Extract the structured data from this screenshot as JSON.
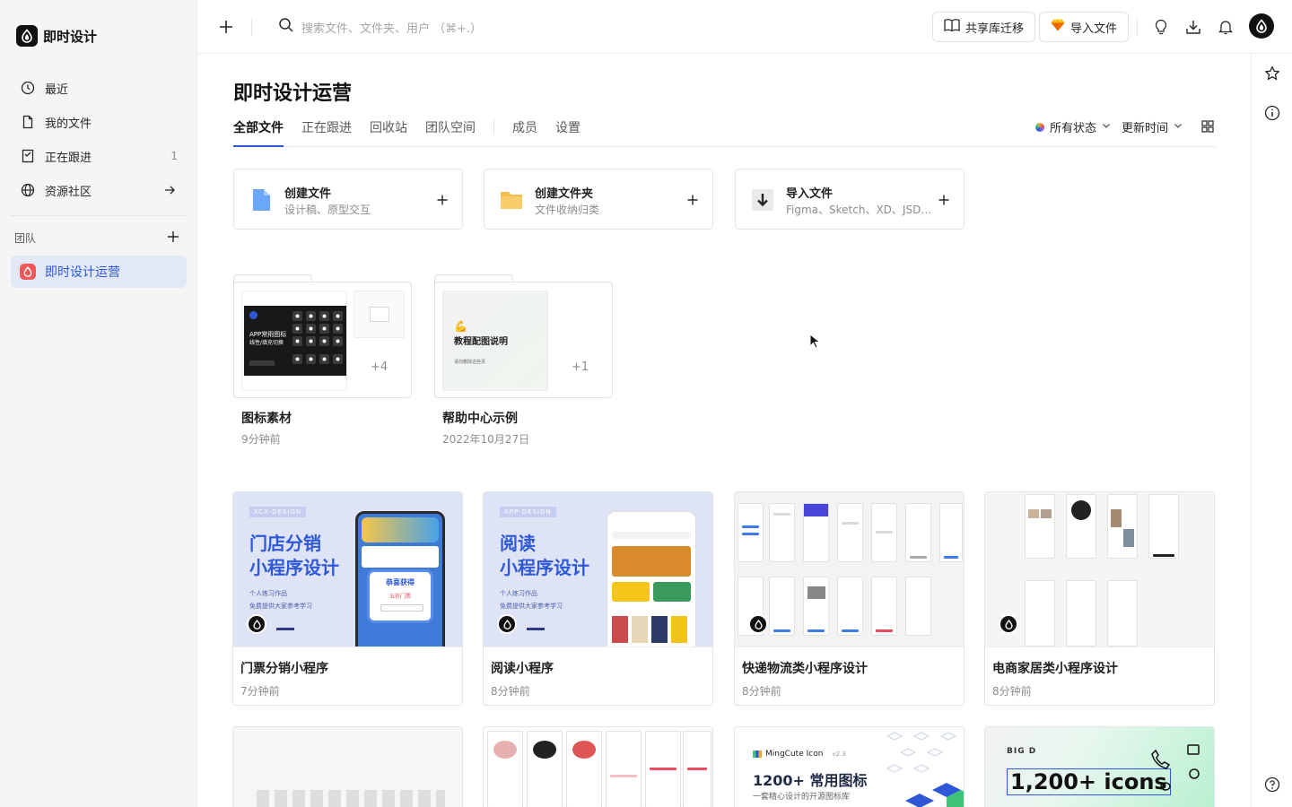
{
  "app": {
    "name": "即时设计"
  },
  "sidebar": {
    "items": [
      {
        "label": "最近",
        "icon": "clock-icon"
      },
      {
        "label": "我的文件",
        "icon": "file-icon"
      },
      {
        "label": "正在跟进",
        "icon": "bookmark-icon",
        "count": "1"
      },
      {
        "label": "资源社区",
        "icon": "globe-icon"
      }
    ],
    "team_section": "团队",
    "team_name": "即时设计运营"
  },
  "topbar": {
    "search_placeholder": "搜索文件、文件夹、用户 （⌘+.）",
    "share_migrate": "共享库迁移",
    "import_file": "导入文件"
  },
  "main": {
    "title": "即时设计运营",
    "tabs": [
      "全部文件",
      "正在跟进",
      "回收站",
      "团队空间",
      "成员",
      "设置"
    ],
    "active_tab": "全部文件",
    "filter_status": "所有状态",
    "sort_by": "更新时间"
  },
  "create_cards": [
    {
      "title": "创建文件",
      "subtitle": "设计稿、原型交互"
    },
    {
      "title": "创建文件夹",
      "subtitle": "文件收纳归类"
    },
    {
      "title": "导入文件",
      "subtitle": "Figma、Sketch、XD、JSD、..."
    }
  ],
  "folders": [
    {
      "title": "图标素材",
      "time": "9分钟前",
      "more": "+4",
      "thumb_title": "APP常用图标",
      "thumb_sub": "线性/填充切换"
    },
    {
      "title": "帮助中心示例",
      "time": "2022年10月27日",
      "more": "+1",
      "thumb_title": "教程配图说明",
      "thumb_sub": "请勿删除这些页"
    }
  ],
  "files": [
    {
      "title": "门票分销小程序",
      "time": "7分钟前",
      "tag": "XCX-DESIGN",
      "headline1": "门店分销",
      "headline2": "小程序设计",
      "bullet1": "个人练习作品",
      "bullet2": "免费提供大家参考学习",
      "popup": "恭喜获得",
      "popup_sub": "五折门票"
    },
    {
      "title": "阅读小程序",
      "time": "8分钟前",
      "tag": "APP-DESIGN",
      "headline1": "阅读",
      "headline2": "小程序设计",
      "bullet1": "个人练习作品",
      "bullet2": "免费提供大家参考学习"
    },
    {
      "title": "快递物流类小程序设计",
      "time": "8分钟前"
    },
    {
      "title": "电商家居类小程序设计",
      "time": "8分钟前"
    }
  ],
  "partial_files": [
    {
      "mingcute": "MingCute Icon",
      "version": "v2.3",
      "headline": "1200+ 常用图标",
      "sub": "一套精心设计的开源图标库"
    },
    {
      "brand": "BIG D",
      "headline": "1,200+ icons"
    }
  ],
  "colors": {
    "accent": "#2e58d8",
    "team_bg": "#e3e8f6",
    "xcx_bg": "#dfe3f6"
  }
}
